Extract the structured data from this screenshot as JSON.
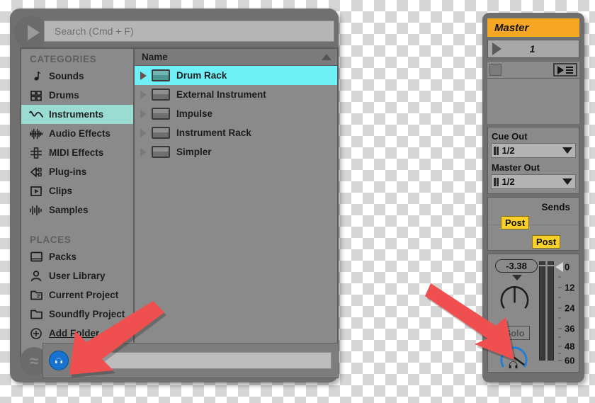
{
  "browser": {
    "play_icon": "play-triangle-icon",
    "search": {
      "placeholder": "Search (Cmd + F)",
      "value": ""
    },
    "categories": {
      "header": "CATEGORIES",
      "items": [
        {
          "label": "Sounds",
          "icon": "music-note-icon",
          "selected": false
        },
        {
          "label": "Drums",
          "icon": "grid-squares-icon",
          "selected": false
        },
        {
          "label": "Instruments",
          "icon": "waveform-curve-icon",
          "selected": true
        },
        {
          "label": "Audio Effects",
          "icon": "audio-wave-icon",
          "selected": false
        },
        {
          "label": "MIDI Effects",
          "icon": "midi-filter-icon",
          "selected": false
        },
        {
          "label": "Plug-ins",
          "icon": "plug-icon",
          "selected": false
        },
        {
          "label": "Clips",
          "icon": "clip-play-icon",
          "selected": false
        },
        {
          "label": "Samples",
          "icon": "sample-wave-icon",
          "selected": false
        }
      ]
    },
    "places": {
      "header": "PLACES",
      "items": [
        {
          "label": "Packs",
          "icon": "package-icon",
          "underline": false
        },
        {
          "label": "User Library",
          "icon": "person-icon",
          "underline": false
        },
        {
          "label": "Current Project",
          "icon": "project-file-icon",
          "underline": false
        },
        {
          "label": "Soundfly Project",
          "icon": "folder-icon",
          "underline": false
        },
        {
          "label": "Add Folder...",
          "icon": "plus-circle-icon",
          "underline": true
        }
      ]
    },
    "list": {
      "column_header": "Name",
      "sort_direction": "ascending",
      "rows": [
        {
          "label": "Drum Rack",
          "selected": true
        },
        {
          "label": "External Instrument",
          "selected": false
        },
        {
          "label": "Impulse",
          "selected": false
        },
        {
          "label": "Instrument Rack",
          "selected": false
        },
        {
          "label": "Simpler",
          "selected": false
        }
      ]
    },
    "footer": {
      "wave_icon": "waveform-circle-icon",
      "preview_icon": "headphone-preview-icon",
      "preview_bar_value": ""
    }
  },
  "master": {
    "title": "Master",
    "scene_number": "1",
    "device_list_icon": "play-list-icon",
    "cue_out": {
      "label": "Cue Out",
      "value": "1/2"
    },
    "master_out": {
      "label": "Master Out",
      "value": "1/2"
    },
    "sends": {
      "label": "Sends",
      "badges": [
        "Post",
        "Post"
      ]
    },
    "volume": "-3.38",
    "solo_label": "Solo",
    "meter": {
      "zero_marker": "0",
      "scale_labels": [
        "0",
        "12",
        "24",
        "36",
        "48",
        "60"
      ]
    }
  },
  "annotations": {
    "arrow_color": "#EF4F4F",
    "arrows": [
      {
        "name": "arrow-pointing-preview-toggle"
      },
      {
        "name": "arrow-pointing-cue-volume-knob"
      }
    ]
  }
}
